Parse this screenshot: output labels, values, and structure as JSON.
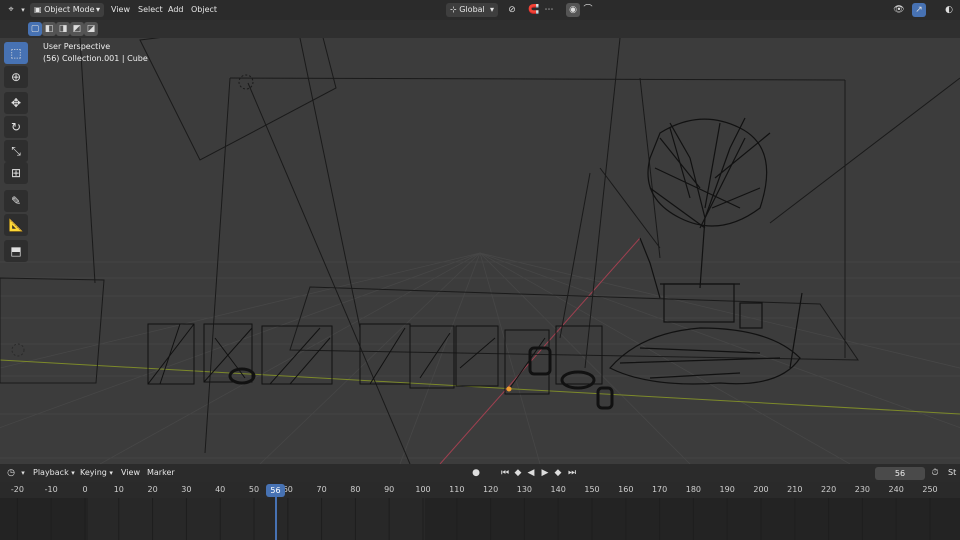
{
  "header": {
    "editor_icon": "3d-viewport-icon",
    "mode": "Object Mode",
    "menu": [
      "View",
      "Select",
      "Add",
      "Object"
    ],
    "transform_orientation": "Global"
  },
  "viewport": {
    "view_name": "User Perspective",
    "context": "(56) Collection.001 | Cube"
  },
  "tools": [
    {
      "name": "select-box-tool",
      "icon": "cursor-select-icon",
      "glyph": "⬚",
      "active": true
    },
    {
      "name": "cursor-tool",
      "icon": "3d-cursor-icon",
      "glyph": "⊕",
      "active": false
    },
    {
      "name": "move-tool",
      "icon": "move-arrows-icon",
      "glyph": "✥",
      "active": false
    },
    {
      "name": "rotate-tool",
      "icon": "rotate-icon",
      "glyph": "↻",
      "active": false
    },
    {
      "name": "scale-tool",
      "icon": "scale-icon",
      "glyph": "⤡",
      "active": false
    },
    {
      "name": "transform-tool",
      "icon": "transform-icon",
      "glyph": "⊞",
      "active": false
    },
    {
      "name": "annotate-tool",
      "icon": "annotate-pen-icon",
      "glyph": "✎",
      "active": false
    },
    {
      "name": "measure-tool",
      "icon": "measure-ruler-icon",
      "glyph": "📐",
      "active": false
    },
    {
      "name": "add-cube-tool",
      "icon": "add-cube-icon",
      "glyph": "⬒",
      "active": false
    }
  ],
  "timeline": {
    "menu": [
      "Playback",
      "Keying",
      "View",
      "Marker"
    ],
    "current_frame": "56",
    "start_label": "St",
    "ruler": [
      "-20",
      "-10",
      "0",
      "10",
      "20",
      "30",
      "40",
      "50",
      "56",
      "60",
      "70",
      "80",
      "90",
      "100",
      "110",
      "120",
      "130",
      "140",
      "150",
      "160",
      "170",
      "180",
      "190",
      "200",
      "210",
      "220",
      "230",
      "240",
      "250"
    ]
  },
  "colors": {
    "accent": "#4772b3",
    "playhead": "#4772b3",
    "x_axis": "#b34a5a",
    "y_axis": "#8a9a2a"
  }
}
